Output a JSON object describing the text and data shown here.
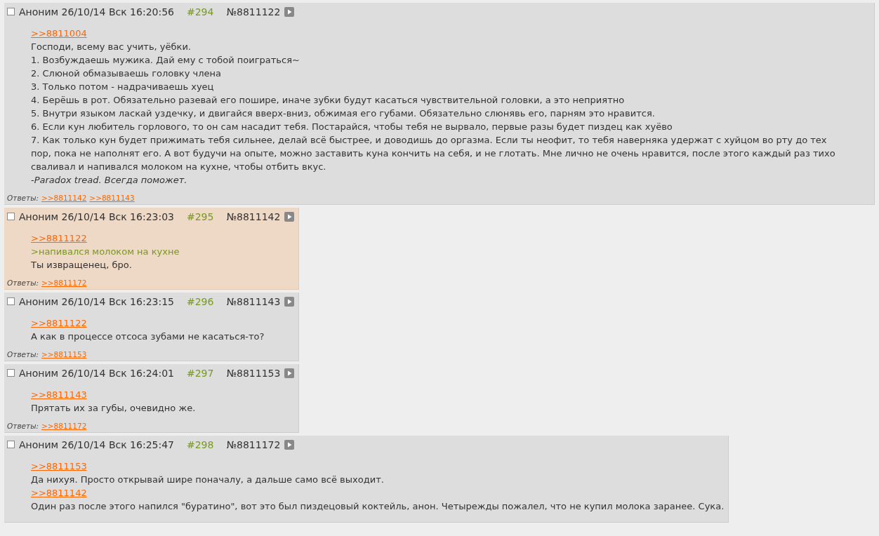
{
  "posts": [
    {
      "checked": false,
      "highlighted": false,
      "meta": "Аноним 26/10/14 Вск 16:20:56",
      "number": "#294",
      "id": "№8811122",
      "lines": [
        {
          "kind": "link",
          "text": ">>8811004"
        },
        {
          "kind": "text",
          "text": "Господи, всему вас учить, уёбки."
        },
        {
          "kind": "text",
          "text": "1. Возбуждаешь мужика. Дай ему с тобой поиграться~"
        },
        {
          "kind": "text",
          "text": "2. Слюной обмазываешь головку члена"
        },
        {
          "kind": "text",
          "text": "3. Только потом - надрачиваешь хуец"
        },
        {
          "kind": "text",
          "text": "4. Берёшь в рот. Обязательно разевай его пошире, иначе зубки будут касаться чувствительной головки, а это неприятно"
        },
        {
          "kind": "text",
          "text": "5. Внутри языком ласкай уздечку, и двигайся вверх-вниз, обжимая его губами. Обязательно слюнявь его, парням это нравится."
        },
        {
          "kind": "text",
          "text": "6. Если кун любитель горлового, то он сам насадит тебя. Постарайся, чтобы тебя не вырвало, первые разы будет пиздец как хуёво"
        },
        {
          "kind": "text",
          "text": "7. Как только кун будет прижимать тебя сильнее, делай всё быстрее, и доводишь до оргазма. Если ты неофит, то тебя наверняка удержат с хуйцом во рту до тех пор, пока не наполнят его. А вот будучи на опыте, можно заставить куна кончить на себя, и не глотать. Мне лично не очень нравится, после этого каждый раз тихо сваливал и напивался молоком на кухне, чтобы отбить вкус."
        },
        {
          "kind": "signature",
          "text": "-Paradox tread. Всегда поможет."
        }
      ],
      "replies": {
        "label": "Ответы:",
        "links": [
          ">>8811142",
          ">>8811143"
        ]
      }
    },
    {
      "checked": false,
      "highlighted": true,
      "meta": "Аноним 26/10/14 Вск 16:23:03",
      "number": "#295",
      "id": "№8811142",
      "lines": [
        {
          "kind": "link",
          "text": ">>8811122"
        },
        {
          "kind": "quote",
          "text": ">напивался молоком на кухне"
        },
        {
          "kind": "text",
          "text": "Ты извращенец, бро."
        }
      ],
      "replies": {
        "label": "Ответы:",
        "links": [
          ">>8811172"
        ]
      }
    },
    {
      "checked": false,
      "highlighted": false,
      "meta": "Аноним 26/10/14 Вск 16:23:15",
      "number": "#296",
      "id": "№8811143",
      "lines": [
        {
          "kind": "link",
          "text": ">>8811122"
        },
        {
          "kind": "text",
          "text": "А как в процессе отсоса зубами не касаться-то?"
        }
      ],
      "replies": {
        "label": "Ответы:",
        "links": [
          ">>8811153"
        ]
      }
    },
    {
      "checked": false,
      "highlighted": false,
      "meta": "Аноним 26/10/14 Вск 16:24:01",
      "number": "#297",
      "id": "№8811153",
      "lines": [
        {
          "kind": "link",
          "text": ">>8811143"
        },
        {
          "kind": "text",
          "text": "Прятать их за губы, очевидно же."
        }
      ],
      "replies": {
        "label": "Ответы:",
        "links": [
          ">>8811172"
        ]
      }
    },
    {
      "checked": false,
      "highlighted": false,
      "meta": "Аноним 26/10/14 Вск 16:25:47",
      "number": "#298",
      "id": "№8811172",
      "lines": [
        {
          "kind": "link",
          "text": ">>8811153"
        },
        {
          "kind": "text",
          "text": "Да нихуя. Просто открывай шире поначалу, а дальше само всё выходит."
        },
        {
          "kind": "link",
          "text": ">>8811142"
        },
        {
          "kind": "text",
          "text": "Один раз после этого напился \"буратино\", вот это был пиздецовый коктейль, анон. Четырежды пожалел, что не купил молока заранее. Сука."
        }
      ]
    }
  ]
}
